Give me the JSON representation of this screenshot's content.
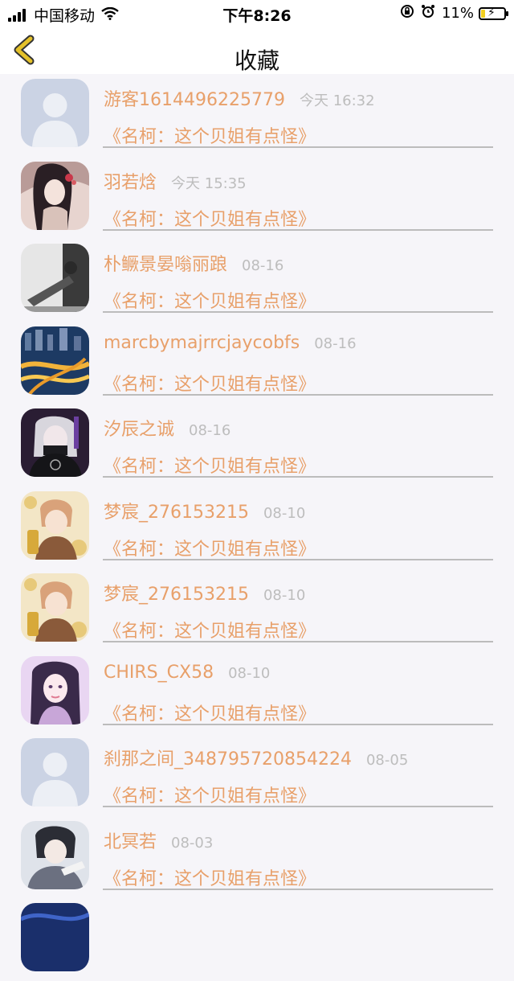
{
  "status_bar": {
    "carrier": "中国移动",
    "time": "下午8:26",
    "battery": "11%"
  },
  "nav": {
    "title": "收藏"
  },
  "favorites": [
    {
      "name": "游客1614496225779",
      "time": "今天 16:32",
      "link": "《名柯：这个贝姐有点怪》",
      "avatar": "default"
    },
    {
      "name": "羽若焓",
      "time": "今天 15:35",
      "link": "《名柯：这个贝姐有点怪》",
      "avatar": "photo-1"
    },
    {
      "name": "朴鳜景晏嗡丽踉",
      "time": "08-16",
      "link": "《名柯：这个贝姐有点怪》",
      "avatar": "photo-2"
    },
    {
      "name": "marcbymajrrcjaycobfs",
      "time": "08-16",
      "link": "《名柯：这个贝姐有点怪》",
      "avatar": "photo-3"
    },
    {
      "name": "汐辰之诚",
      "time": "08-16",
      "link": "《名柯：这个贝姐有点怪》",
      "avatar": "photo-4"
    },
    {
      "name": "梦宸_276153215",
      "time": "08-10",
      "link": "《名柯：这个贝姐有点怪》",
      "avatar": "photo-5"
    },
    {
      "name": "梦宸_276153215",
      "time": "08-10",
      "link": "《名柯：这个贝姐有点怪》",
      "avatar": "photo-5"
    },
    {
      "name": "CHIRS_CX58",
      "time": "08-10",
      "link": "《名柯：这个贝姐有点怪》",
      "avatar": "photo-6"
    },
    {
      "name": "刹那之间_348795720854224",
      "time": "08-05",
      "link": "《名柯：这个贝姐有点怪》",
      "avatar": "default"
    },
    {
      "name": "北冥若",
      "time": "08-03",
      "link": "《名柯：这个贝姐有点怪》",
      "avatar": "photo-7"
    }
  ],
  "colors": {
    "accent": "#e8a06a",
    "time_gray": "#bdbdbd",
    "back_arrow": "#e4c12a",
    "background": "#f6f5f9"
  }
}
